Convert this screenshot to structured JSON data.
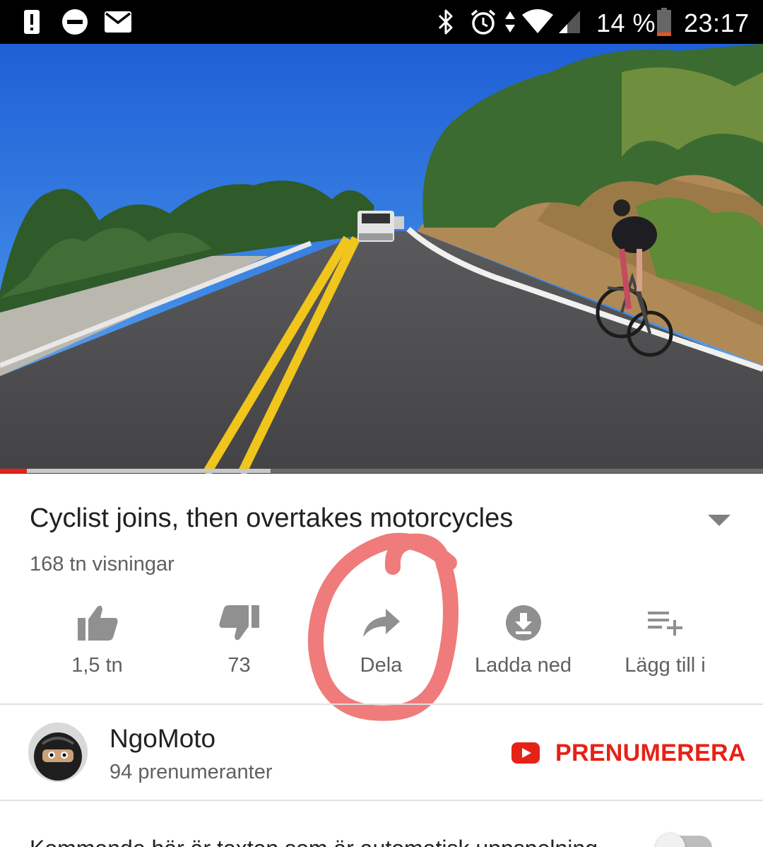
{
  "status_bar": {
    "battery_percent": "14 %",
    "time": "23:17",
    "battery_level": 0.14,
    "icons_left": [
      "alert-icon",
      "do-not-disturb-icon",
      "mail-icon"
    ],
    "icons_right": [
      "bluetooth-icon",
      "alarm-icon",
      "data-arrows-icon",
      "wifi-icon",
      "cell-signal-icon",
      "battery-icon"
    ]
  },
  "video": {
    "progress_played": 0.035,
    "progress_buffered": 0.355,
    "colors": {
      "played": "#e62117",
      "buffered": "#c8c8c8",
      "track": "#6b6b6b"
    }
  },
  "video_info": {
    "title": "Cyclist joins, then overtakes motorcycles",
    "views": "168 tn visningar"
  },
  "actions": [
    {
      "icon": "thumbs-up-icon",
      "label": "1,5 tn"
    },
    {
      "icon": "thumbs-down-icon",
      "label": "73"
    },
    {
      "icon": "share-icon",
      "label": "Dela"
    },
    {
      "icon": "download-icon",
      "label": "Ladda ned"
    },
    {
      "icon": "add-to-playlist-icon",
      "label": "Lägg till i"
    }
  ],
  "channel": {
    "name": "NgoMoto",
    "subscribers": "94 prenumeranter",
    "subscribe_label": "PRENUMERERA",
    "brand_color": "#e62117"
  },
  "autoplay": {
    "label": "Kommande här är texten som är automatisk uppspelning"
  },
  "annotation": {
    "color": "#f07b7b"
  }
}
